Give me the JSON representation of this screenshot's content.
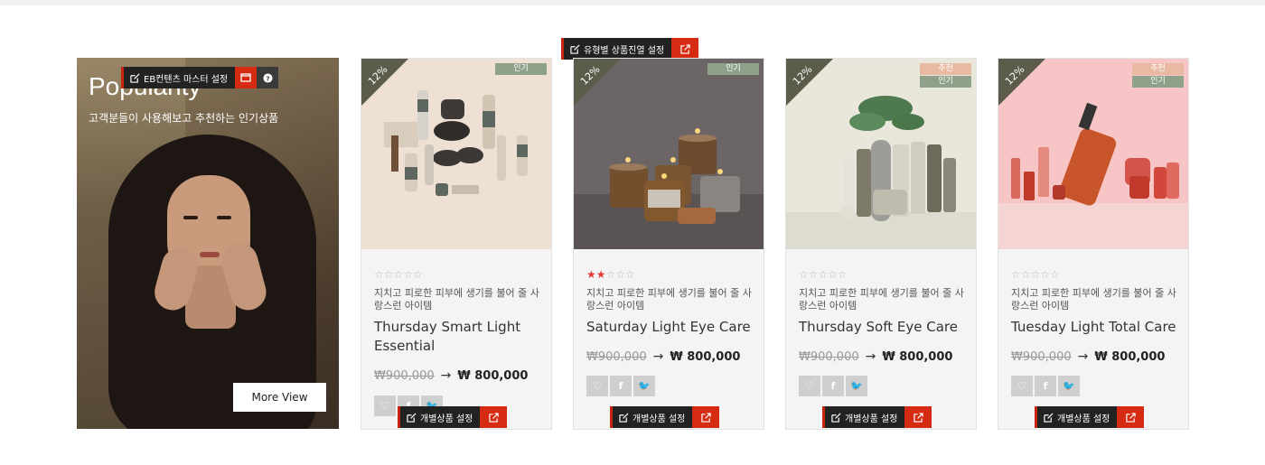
{
  "admin": {
    "master_setting": "EB컨텐츠 마스터 설정",
    "type_setting": "유형별 상품진열 설정",
    "item_setting": "개별상품 설정"
  },
  "hero": {
    "title": "Popularity",
    "subtitle": "고객분들이 사용해보고 추천하는 인기상품",
    "button": "More View"
  },
  "products": [
    {
      "discount": "12%",
      "badges": [
        "인기"
      ],
      "rating": 0,
      "stars": "☆☆☆☆☆",
      "description": "지치고 피로한 피부에 생기를 불어 줄 사랑스런 아이템",
      "name": "Thursday Smart Light Essential",
      "price_old": "₩900,000",
      "price_new": "₩ 800,000"
    },
    {
      "discount": "12%",
      "badges": [
        "인기"
      ],
      "rating": 2,
      "stars": "★★☆☆☆",
      "description": "지치고 피로한 피부에 생기를 불어 줄 사랑스런 아이템",
      "name": "Saturday Light Eye Care",
      "price_old": "₩900,000",
      "price_new": "₩ 800,000"
    },
    {
      "discount": "12%",
      "badges": [
        "추천",
        "인기"
      ],
      "rating": 0,
      "stars": "☆☆☆☆☆",
      "description": "지치고 피로한 피부에 생기를 불어 줄 사랑스런 아이템",
      "name": "Thursday Soft Eye Care",
      "price_old": "₩900,000",
      "price_new": "₩ 800,000"
    },
    {
      "discount": "12%",
      "badges": [
        "추천",
        "인기"
      ],
      "rating": 0,
      "stars": "☆☆☆☆☆",
      "description": "지치고 피로한 피부에 생기를 불어 줄 사랑스런 아이템",
      "name": "Tuesday Light Total Care",
      "price_old": "₩900,000",
      "price_new": "₩ 800,000"
    }
  ],
  "social": [
    "heart-icon",
    "facebook-icon",
    "twitter-icon"
  ],
  "colors": {
    "accent_red": "#d52b13",
    "ribbon": "#5b5c4a",
    "badge_popular": "#8fa289",
    "badge_recommend": "#e8b9a3",
    "star_on": "#e03a3a"
  }
}
